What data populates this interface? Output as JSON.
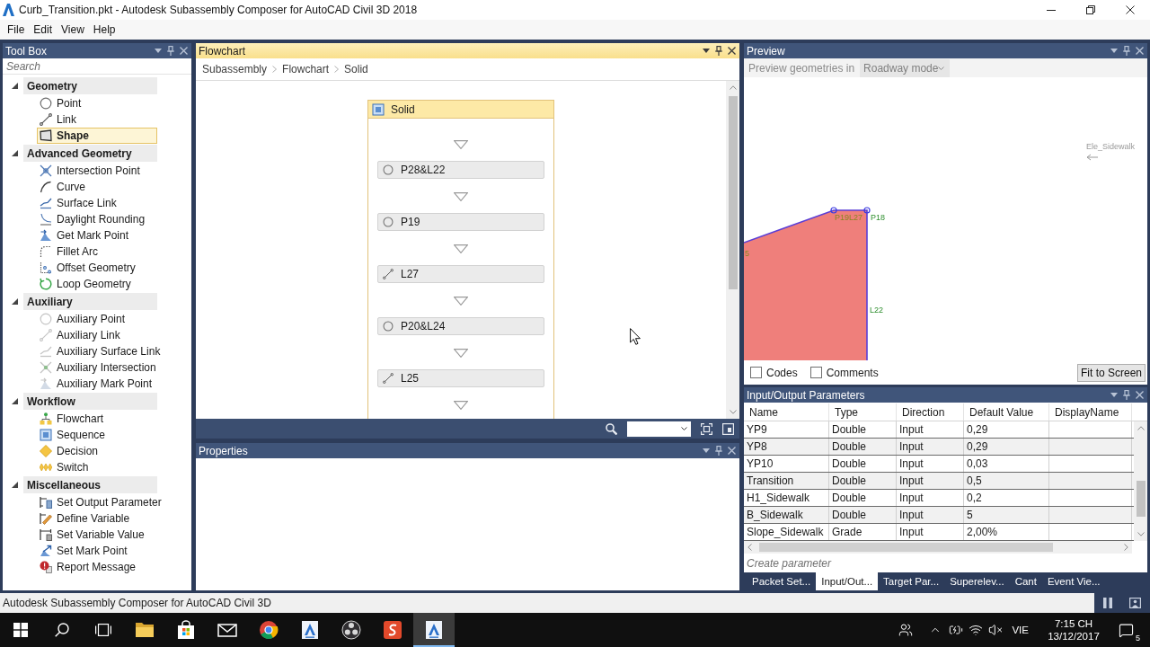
{
  "window": {
    "title": "Curb_Transition.pkt - Autodesk Subassembly Composer for AutoCAD Civil 3D 2018"
  },
  "menu": [
    "File",
    "Edit",
    "View",
    "Help"
  ],
  "toolbox": {
    "title": "Tool Box",
    "active": false,
    "search": {
      "placeholder": "Search"
    },
    "groups": [
      {
        "label": "Geometry",
        "expanded": true,
        "children": [
          {
            "label": "Point",
            "kind": "point",
            "selected": false
          },
          {
            "label": "Link",
            "kind": "link",
            "selected": false
          },
          {
            "label": "Shape",
            "kind": "shape",
            "selected": true
          }
        ]
      },
      {
        "label": "Advanced Geometry",
        "expanded": true,
        "children": [
          {
            "label": "Intersection Point",
            "kind": "intersection",
            "selected": false
          },
          {
            "label": "Curve",
            "kind": "curve",
            "selected": false
          },
          {
            "label": "Surface Link",
            "kind": "surface",
            "selected": false
          },
          {
            "label": "Daylight Rounding",
            "kind": "daylight",
            "selected": false
          },
          {
            "label": "Get Mark Point",
            "kind": "getmark",
            "selected": false
          },
          {
            "label": "Fillet Arc",
            "kind": "fillet",
            "selected": false
          },
          {
            "label": "Offset Geometry",
            "kind": "offset",
            "selected": false
          },
          {
            "label": "Loop Geometry",
            "kind": "loop",
            "selected": false
          }
        ]
      },
      {
        "label": "Auxiliary",
        "expanded": true,
        "children": [
          {
            "label": "Auxiliary Point",
            "kind": "auxpoint",
            "selected": false
          },
          {
            "label": "Auxiliary Link",
            "kind": "auxlink",
            "selected": false
          },
          {
            "label": "Auxiliary Surface Link",
            "kind": "auxsurface",
            "selected": false
          },
          {
            "label": "Auxiliary Intersection",
            "kind": "auxintersection",
            "selected": false
          },
          {
            "label": "Auxiliary Mark Point",
            "kind": "auxmark",
            "selected": false
          }
        ]
      },
      {
        "label": "Workflow",
        "expanded": true,
        "children": [
          {
            "label": "Flowchart",
            "kind": "flowchart",
            "selected": false
          },
          {
            "label": "Sequence",
            "kind": "sequence",
            "selected": false
          },
          {
            "label": "Decision",
            "kind": "decision",
            "selected": false
          },
          {
            "label": "Switch",
            "kind": "switch",
            "selected": false
          }
        ]
      },
      {
        "label": "Miscellaneous",
        "expanded": true,
        "children": [
          {
            "label": "Set Output Parameter",
            "kind": "output",
            "selected": false
          },
          {
            "label": "Define Variable",
            "kind": "define",
            "selected": false
          },
          {
            "label": "Set Variable Value",
            "kind": "setvalue",
            "selected": false
          },
          {
            "label": "Set Mark Point",
            "kind": "setmark",
            "selected": false
          },
          {
            "label": "Report Message",
            "kind": "report",
            "selected": false
          }
        ]
      }
    ]
  },
  "flowchart": {
    "title": "Flowchart",
    "active": true,
    "breadcrumb": [
      "Subassembly",
      "Flowchart",
      "Solid"
    ],
    "sequence": {
      "label": "Solid",
      "steps": [
        {
          "label": "P28&L22",
          "kind": "point"
        },
        {
          "label": "P19",
          "kind": "point"
        },
        {
          "label": "L27",
          "kind": "link"
        },
        {
          "label": "P20&L24",
          "kind": "point"
        },
        {
          "label": "L25",
          "kind": "link"
        }
      ]
    }
  },
  "properties": {
    "title": "Properties",
    "active": false
  },
  "preview": {
    "title": "Preview",
    "active": false,
    "mode_label": "Preview geometries in",
    "mode": {
      "value": "Roadway mode",
      "disabled": true
    },
    "labels": [
      "P19",
      "L27",
      "P18",
      "L22",
      "5"
    ],
    "target_label": "Ele_Sidewalk",
    "options": [
      {
        "label": "Codes",
        "checked": false
      },
      {
        "label": "Comments",
        "checked": false
      }
    ],
    "fit_button": "Fit to Screen"
  },
  "parameters": {
    "title": "Input/Output Parameters",
    "active": false,
    "columns": [
      "Name",
      "Type",
      "Direction",
      "Default Value",
      "DisplayName"
    ],
    "rows": [
      [
        "YP9",
        "Double",
        "Input",
        "0,29"
      ],
      [
        "YP8",
        "Double",
        "Input",
        "0,29"
      ],
      [
        "YP10",
        "Double",
        "Input",
        "0,03"
      ],
      [
        "Transition",
        "Double",
        "Input",
        "0,5"
      ],
      [
        "H1_Sidewalk",
        "Double",
        "Input",
        "0,2"
      ],
      [
        "B_Sidewalk",
        "Double",
        "Input",
        "5"
      ],
      [
        "Slope_Sidewalk",
        "Grade",
        "Input",
        "2,00%"
      ]
    ],
    "create": {
      "placeholder": "Create parameter"
    },
    "tabs": [
      {
        "label": "Packet Set...",
        "selected": false
      },
      {
        "label": "Input/Out...",
        "selected": true
      },
      {
        "label": "Target Par...",
        "selected": false
      },
      {
        "label": "Superelev...",
        "selected": false
      },
      {
        "label": "Cant",
        "selected": false
      },
      {
        "label": "Event Vie...",
        "selected": false
      }
    ]
  },
  "status_bar": {
    "text": "Autodesk Subassembly Composer for AutoCAD Civil 3D"
  },
  "taskbar": {
    "apps": [
      {
        "kind": "folder",
        "selected": false
      },
      {
        "kind": "store",
        "selected": false
      },
      {
        "kind": "mail",
        "selected": false
      },
      {
        "kind": "browser",
        "selected": false
      },
      {
        "kind": "autocad",
        "selected": false
      },
      {
        "kind": "recorder",
        "selected": false
      },
      {
        "kind": "sketch",
        "selected": false
      },
      {
        "kind": "composer",
        "selected": true
      }
    ],
    "tray": {
      "language": "VIE",
      "time": "7:15 CH",
      "date": "13/12/2017",
      "notifications": "5"
    }
  }
}
